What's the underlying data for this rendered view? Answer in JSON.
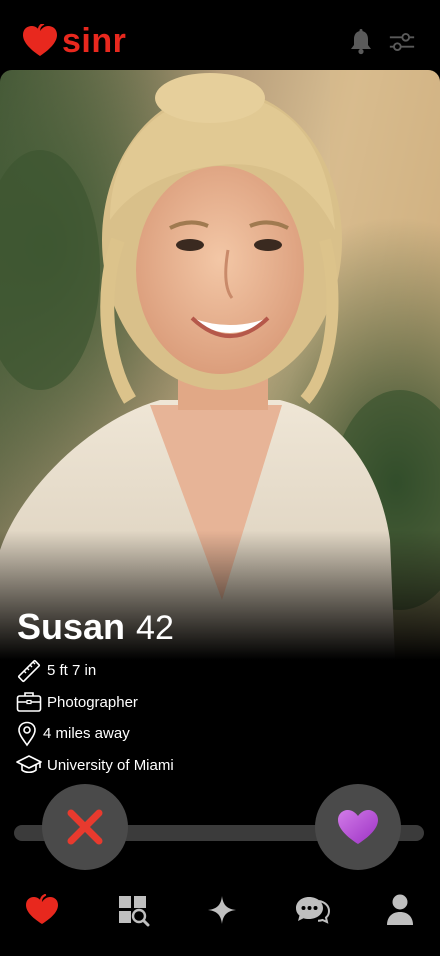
{
  "app": {
    "brand_name": "sinr",
    "brand_color": "#e8281e"
  },
  "header": {
    "icons": [
      "notifications-icon",
      "filters-icon"
    ]
  },
  "profile": {
    "name": "Susan",
    "age": "42",
    "details": [
      {
        "icon": "ruler-icon",
        "text": "5 ft 7 in"
      },
      {
        "icon": "briefcase-icon",
        "text": "Photographer"
      },
      {
        "icon": "location-pin-icon",
        "text": "4 miles away"
      },
      {
        "icon": "graduation-cap-icon",
        "text": "University of Miami"
      }
    ]
  },
  "actions": {
    "nope_icon": "x-icon",
    "like_icon": "heart-icon",
    "like_color": "#b14fd6",
    "nope_color": "#e83a2e"
  },
  "nav": {
    "items": [
      "discover-icon",
      "explore-icon",
      "spark-icon",
      "messages-icon",
      "profile-icon"
    ],
    "active_color": "#e8281e",
    "inactive_color": "#bfbfbf"
  }
}
